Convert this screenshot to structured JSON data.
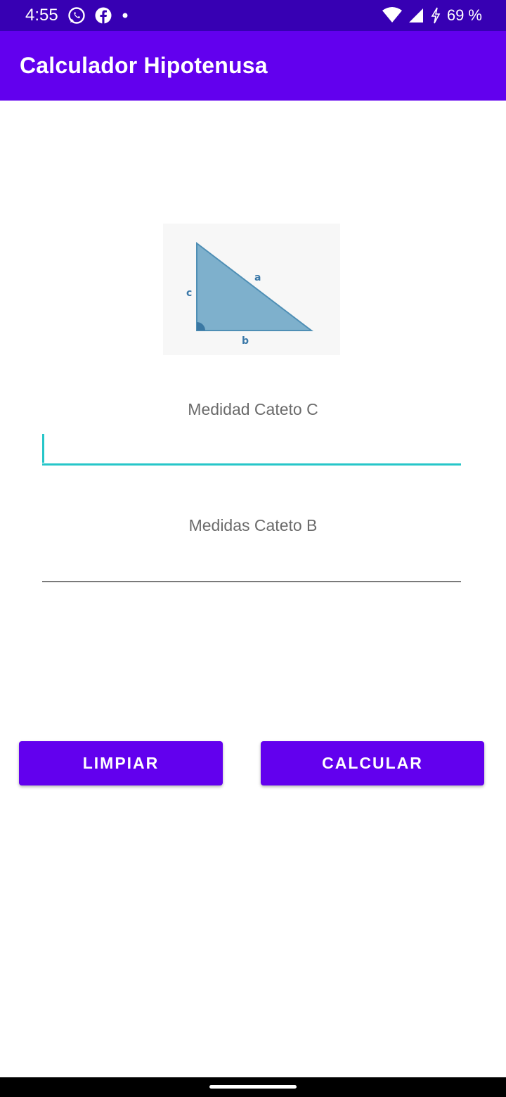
{
  "status_bar": {
    "time": "4:55",
    "battery": "69 %",
    "icons": [
      "whatsapp-icon",
      "facebook-icon",
      "notification-dot-icon",
      "wifi-icon",
      "signal-icon",
      "charging-icon"
    ]
  },
  "app_bar": {
    "title": "Calculador Hipotenusa",
    "color": "#6200ee"
  },
  "diagram": {
    "labels": {
      "hypotenuse": "a",
      "leg_vertical": "c",
      "leg_horizontal": "b"
    }
  },
  "form": {
    "cateto_c": {
      "label": "Medidad Cateto C",
      "value": ""
    },
    "cateto_b": {
      "label": "Medidas Cateto B",
      "value": ""
    }
  },
  "buttons": {
    "clear": "LIMPIAR",
    "calculate": "CALCULAR"
  },
  "colors": {
    "primary": "#6200ee",
    "primary_dark": "#3700b3",
    "accent": "#26c6c9"
  }
}
